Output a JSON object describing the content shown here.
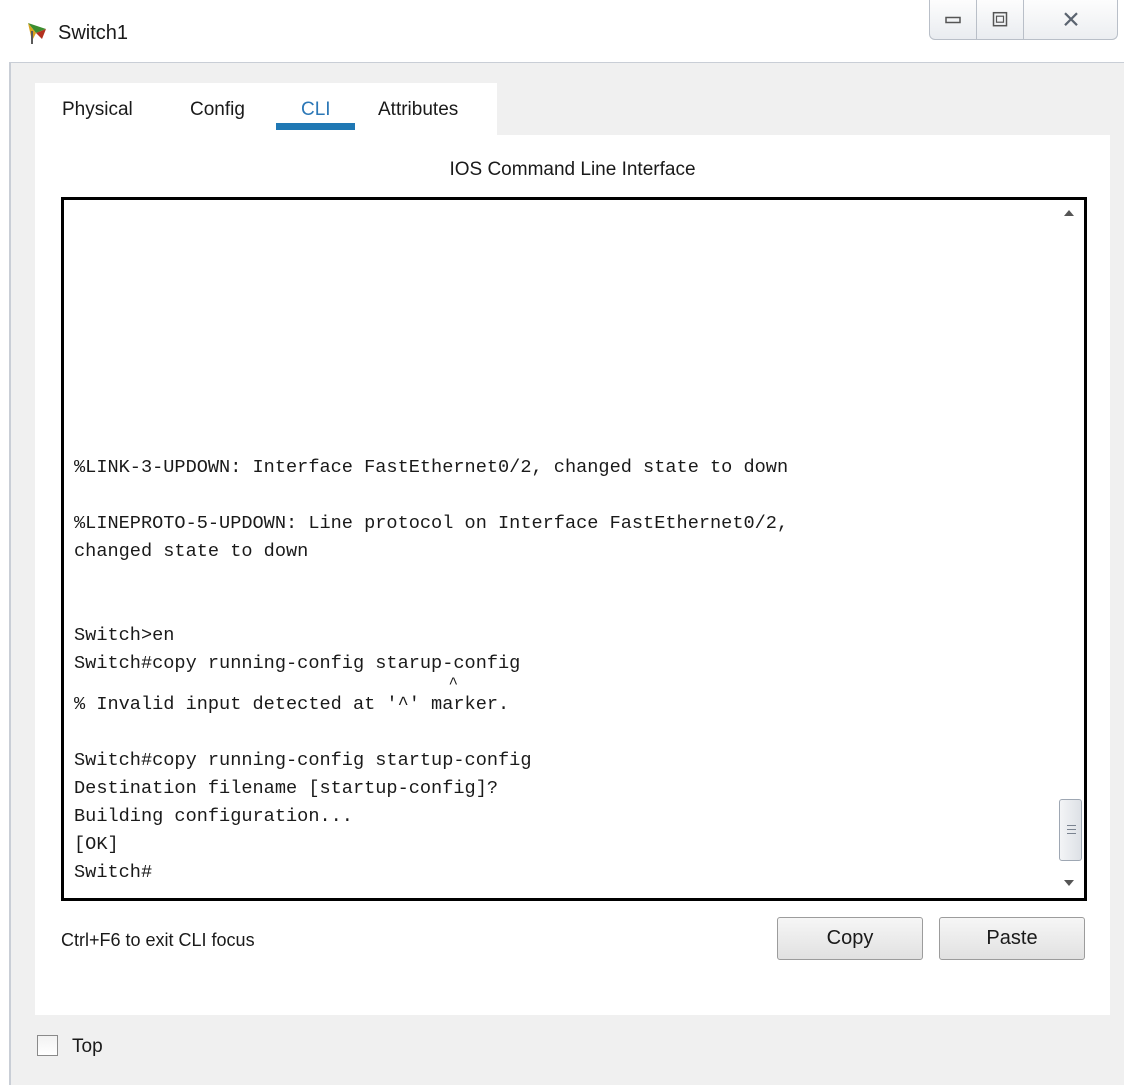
{
  "window": {
    "title": "Switch1",
    "icon": "packet-tracer-switch-icon",
    "controls": [
      "minimize-icon",
      "maximize-icon",
      "close-icon"
    ]
  },
  "tabs": [
    {
      "label": "Physical",
      "active": false
    },
    {
      "label": "Config",
      "active": false
    },
    {
      "label": "CLI",
      "active": true
    },
    {
      "label": "Attributes",
      "active": false
    }
  ],
  "cli": {
    "header": "IOS Command Line Interface",
    "lines": [
      "%LINK-3-UPDOWN: Interface FastEthernet0/2, changed state to down",
      "",
      "%LINEPROTO-5-UPDOWN: Line protocol on Interface FastEthernet0/2,",
      "changed state to down",
      "",
      "",
      "Switch>en",
      "Switch#copy running-config starup-config",
      "                                       ^",
      "% Invalid input detected at '^' marker.",
      "",
      "Switch#copy running-config startup-config",
      "Destination filename [startup-config]?",
      "Building configuration...",
      "[OK]",
      "Switch#"
    ],
    "hint": "Ctrl+F6 to exit CLI focus",
    "copy_label": "Copy",
    "paste_label": "Paste"
  },
  "footer": {
    "top_label": "Top",
    "top_checked": false
  },
  "colors": {
    "accent": "#1f78b4",
    "active_tab_text": "#2c78b7",
    "panel_bg": "#f0f0f0"
  }
}
